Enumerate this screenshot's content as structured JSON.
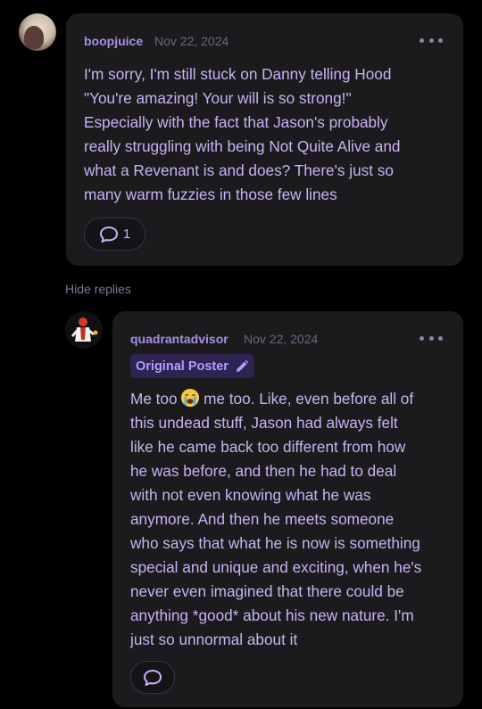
{
  "comment": {
    "username": "boopjuice",
    "date": "Nov 22, 2024",
    "text": "I'm sorry, I'm still stuck on Danny telling Hood\n\"You're amazing! Your will is so strong!\"\nEspecially with the fact that Jason's probably\nreally struggling with being Not Quite Alive and\nwhat a Revenant is and does? There's just so\nmany warm fuzzies in those few lines",
    "reply_count": "1",
    "icons": {
      "more": "more-dots-icon",
      "reply": "speech-bubble-icon"
    }
  },
  "hide_replies_label": "Hide replies",
  "reply": {
    "username": "quadrantadvisor",
    "date": "Nov 22, 2024",
    "badge_label": "Original Poster",
    "text_first": "Me too",
    "emoji": "loudly-crying-face-emoji",
    "text_rest": " me too. Like, even before all of\nthis undead stuff, Jason had always felt\nlike he came back too different from how\nhe was before, and then he had to deal\nwith not even knowing what he was\nanymore. And then he meets someone\nwho says that what he is now is something\nspecial and unique and exciting, when he's\nnever even imagined that there could be\nanything *good* about his new nature. I'm\njust so unnormal about it",
    "icons": {
      "more": "more-dots-icon",
      "reply": "speech-bubble-icon",
      "badge": "pencil-icon"
    }
  },
  "colors": {
    "background": "#000000",
    "card": "#1b1a1c",
    "username": "#a88fe6",
    "body_text": "#c9b2f5",
    "date": "#6f6580",
    "badge_bg": "#2d2452",
    "badge_text": "#b89bff"
  }
}
